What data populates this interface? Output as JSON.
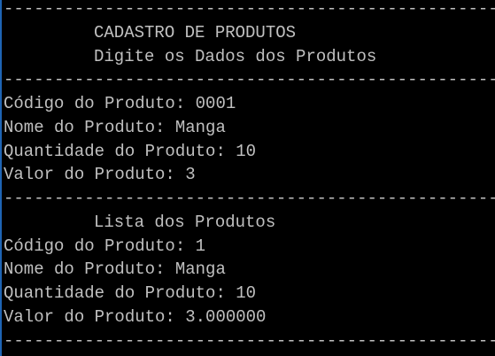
{
  "console": {
    "colors": {
      "background": "#000000",
      "text": "#c0c0c0",
      "window_edge": "#1e64b4"
    },
    "separator": "----------------------------------------------------------------",
    "header": {
      "title": "CADASTRO DE PRODUTOS",
      "subtitle": "Digite os Dados dos Produtos"
    },
    "input_section": {
      "codigo": "Código do Produto: 0001",
      "nome": "Nome do Produto: Manga",
      "quantidade": "Quantidade do Produto: 10",
      "valor": "Valor do Produto: 3"
    },
    "list_section": {
      "title": "Lista dos Produtos",
      "codigo": "Código do Produto: 1",
      "nome": "Nome do Produto: Manga",
      "quantidade": "Quantidade do Produto: 10",
      "valor": "Valor do Produto: 3.000000"
    }
  }
}
